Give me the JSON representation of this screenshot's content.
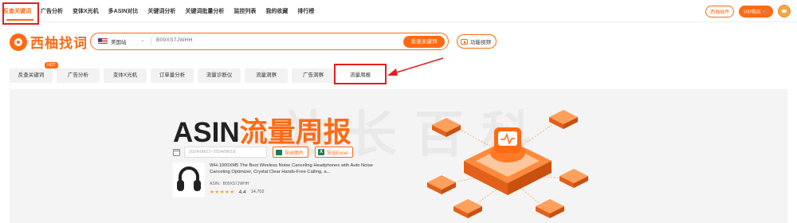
{
  "topnav": {
    "items": [
      "反查关键词",
      "广告分析",
      "变体X光机",
      "多ASIN对比",
      "关键词分析",
      "关键词批量分析",
      "监控列表",
      "我的收藏",
      "排行榜"
    ],
    "plugin_label": "西柚插件",
    "vip_label": "VIP购买"
  },
  "logo": {
    "text": "西柚找词"
  },
  "search": {
    "site": "美国站",
    "value": "B09XS7JWHH",
    "button_label": "反查关键词",
    "video_label": "功能视频"
  },
  "tabs": {
    "items": [
      "反查关键词",
      "广告分析",
      "变体X光机",
      "订单量分析",
      "流量诊断仪",
      "流量洞察",
      "广告洞察",
      "流量周报"
    ],
    "hot_badge": "HOT",
    "active": "流量周报"
  },
  "banner": {
    "watermark": "站长百科",
    "title_en": "ASIN",
    "title_cn": "流量周报",
    "date_range": "2024/08/12~2024/08/18",
    "export_image_label": "导出图片",
    "export_excel_label": "导出Excel",
    "excel_icon_letter": "X"
  },
  "product": {
    "title": "WH-1000XM5 The Best Wireless Noise Canceling Headphones with Auto Noise Canceling Optimizer, Crystal Clear Hands-Free Calling, a...",
    "asin_label": "ASIN：B09XS7JWHH",
    "stars": "★★★★★",
    "rating": "4.4",
    "reviews": "14,702"
  },
  "colors": {
    "accent": "#ff6a13",
    "highlight": "#e02020"
  }
}
